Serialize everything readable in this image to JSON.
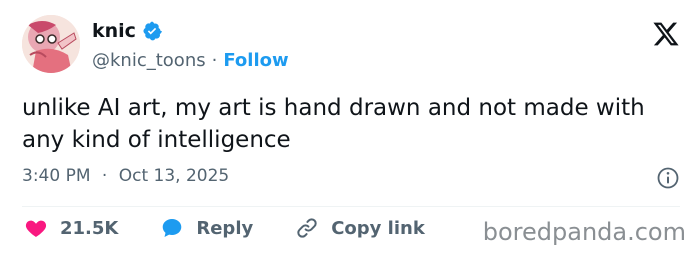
{
  "author": {
    "display_name": "knic",
    "handle": "@knic_toons",
    "separator": "·",
    "follow_label": "Follow",
    "verified_color": "#1d9bf0"
  },
  "platform_icon": "x-logo-icon",
  "tweet": {
    "text": "unlike AI art, my art is hand drawn and not made with any kind of intelligence",
    "time": "3:40 PM",
    "separator": "·",
    "date": "Oct 13, 2025"
  },
  "actions": {
    "like_count": "21.5K",
    "reply_label": "Reply",
    "copy_link_label": "Copy link"
  },
  "watermark": "boredpanda.com",
  "colors": {
    "accent": "#1d9bf0",
    "like": "#f91880",
    "text": "#0f1419",
    "muted": "#536471"
  }
}
